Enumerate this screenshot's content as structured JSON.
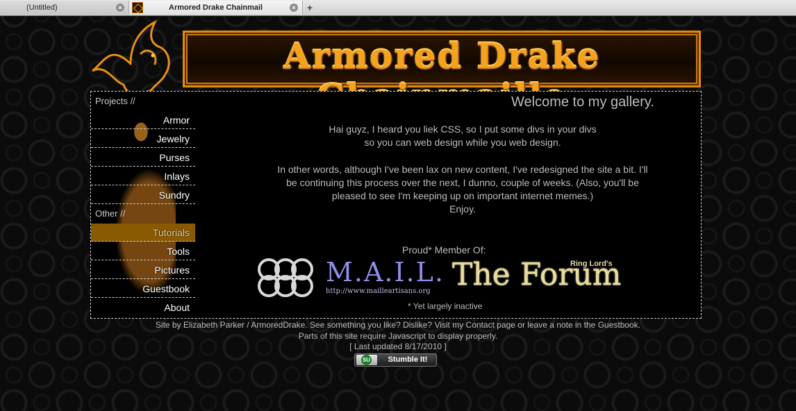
{
  "tabs": [
    {
      "title": "(Untitled)",
      "close": "×"
    },
    {
      "title": "Armored Drake Chainmail",
      "close": "×"
    }
  ],
  "new_tab": "+",
  "icons": [
    "favicon-icon",
    "close-icon",
    "new-tab-icon",
    "dragon-logo-icon",
    "rings-logo-icon",
    "stumbleupon-icon"
  ],
  "colors": {
    "accent": "#f3a21d",
    "active_nav": "#8a5a00",
    "mail": "#8f8fe8"
  },
  "banner": {
    "title": "Armored Drake Chainmaille"
  },
  "sidebar": {
    "projects_label": "Projects //",
    "projects": [
      "Armor",
      "Jewelry",
      "Purses",
      "Inlays",
      "Sundry"
    ],
    "other_label": "Other //",
    "other": [
      "Tutorials",
      "Tools",
      "Pictures",
      "Guestbook",
      "About"
    ],
    "active": "Tutorials"
  },
  "main": {
    "welcome": "Welcome to my gallery.",
    "lines": [
      "Hai guyz, I heard you liek CSS, so I put some divs in your divs",
      "so you can web design while you web design.",
      "In other words, although I've been lax on new content, I've redesigned the site a bit. I'll",
      "be continuing this process over the next, I dunno, couple of weeks. (Also, you'll be",
      "pleased to see I'm keeping up on important internet memes.)",
      "Enjoy."
    ],
    "proud": "Proud* Member Of:",
    "mail_logo": "M.A.I.L.",
    "mail_url": "http://www.mailleartisans.org",
    "ringlord": "Ring Lord's",
    "forum_logo": "The Forum",
    "inactive": "* Yet largely inactive"
  },
  "footer": {
    "credit": "Site by Elizabeth Parker / ArmoredDrake. See something you like? Dislike? Visit my Contact page or leave a note in the Guestbook.",
    "js_note": "Parts of this site require Javascript to display properly.",
    "updated": "[ Last updated 8/17/2010 ]",
    "stumble_icon": "SU",
    "stumble_label": "Stumble It!"
  }
}
